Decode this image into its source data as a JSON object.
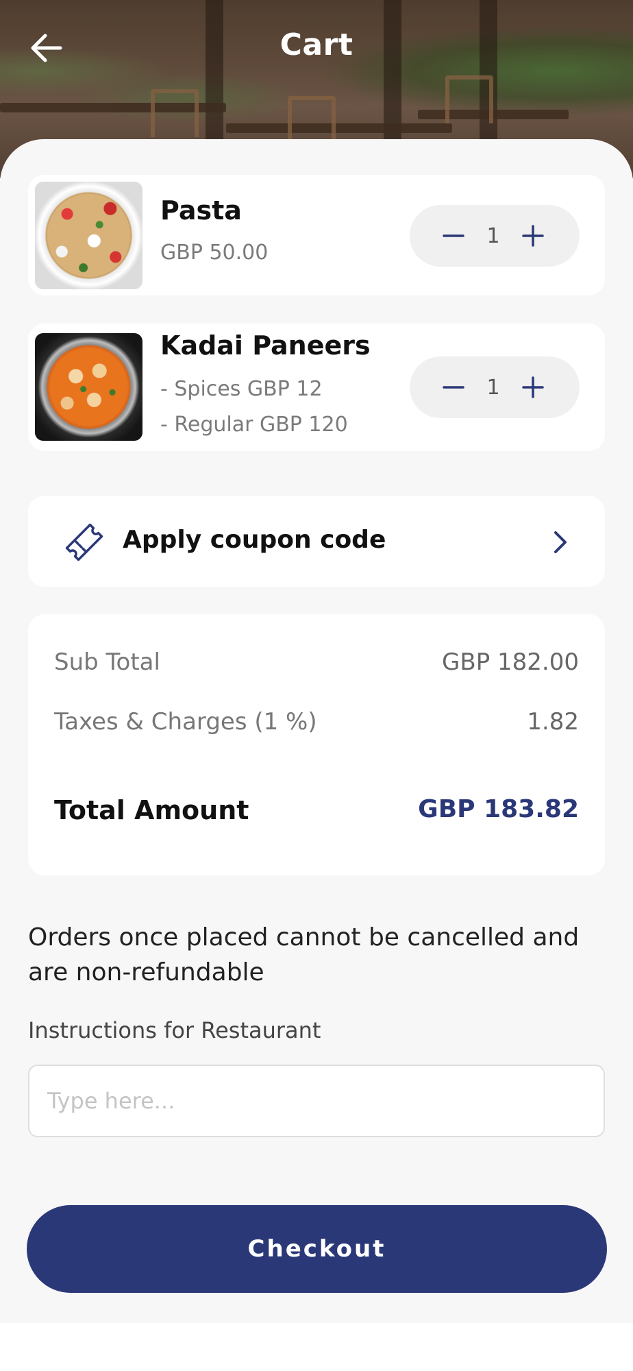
{
  "header": {
    "title": "Cart",
    "back_icon": "arrow-left-icon"
  },
  "cart_items": [
    {
      "name": "Pasta",
      "price": "GBP 50.00",
      "quantity": "1",
      "image_icon": "pasta-photo"
    },
    {
      "name": "Kadai Paneers",
      "options": [
        "- Spices GBP 12",
        "- Regular GBP 120"
      ],
      "quantity": "1",
      "image_icon": "kadai-paneer-photo"
    }
  ],
  "coupon": {
    "label": "Apply coupon code",
    "icon": "coupon-ticket-icon"
  },
  "summary": {
    "subtotal_label": "Sub Total",
    "subtotal_value": "GBP 182.00",
    "taxes_label": "Taxes & Charges (1 %)",
    "taxes_value": "1.82",
    "total_label": "Total Amount",
    "total_value": "GBP 183.82"
  },
  "notice": "Orders once placed cannot be cancelled and are non-refundable",
  "instructions": {
    "label": "Instructions for Restaurant",
    "placeholder": "Type here...",
    "value": ""
  },
  "checkout": {
    "label": "Checkout"
  },
  "colors": {
    "accent": "#2b3878",
    "background": "#f7f7f7",
    "card": "#ffffff"
  }
}
